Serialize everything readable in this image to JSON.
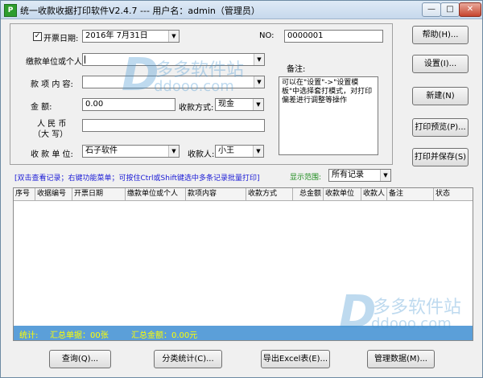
{
  "window": {
    "title": "统一收款收据打印软件V2.4.7 --- 用户名：admin（管理员）",
    "app_icon": "P",
    "controls": {
      "minimize": "—",
      "maximize": "□",
      "close": "✕"
    }
  },
  "form": {
    "date_checkbox_checked": true,
    "date_label": "开票日期:",
    "date_value": "2016年  7月31日",
    "no_label": "NO:",
    "no_value": "0000001",
    "payer_label": "缴款单位或个人:",
    "payer_value": "",
    "item_label": "款  项  内  容:",
    "item_value": "",
    "amount_label": "金        额:",
    "amount_value": "0.00",
    "method_label": "收款方式:",
    "method_value": "现金",
    "rmb_label_top": "人    民    币",
    "rmb_label_bottom": "（大    写）",
    "rmb_value": "",
    "unit_label": "收  款  单  位:",
    "unit_value": "石子软件",
    "receiver_label": "收款人:",
    "receiver_value": "小王",
    "remark_label": "备注:",
    "remark_text": "可以在\"设置\"->\"设置模板\"中选择套打模式，对打印偏差进行调整等操作"
  },
  "side_buttons": [
    "帮助(H)...",
    "设置(I)...",
    "新建(N)",
    "打印预览(P)...",
    "打印并保存(S)"
  ],
  "list_hint": "[双击查看记录；右键功能菜单；可按住Ctrl或Shift键选中多条记录批量打印]",
  "range_label": "显示范围:",
  "range_value": "所有记录",
  "table": {
    "columns": [
      "序号",
      "收据编号",
      "开票日期",
      "缴款单位或个人",
      "款项内容",
      "收款方式",
      "总金额",
      "收款单位",
      "收款人",
      "备注",
      "状态"
    ],
    "rows": []
  },
  "status": {
    "stats_label": "统计:",
    "total_count": "汇总单据：00张",
    "total_amount": "汇总金额：0.00元"
  },
  "bottom_buttons": [
    "查询(Q)...",
    "分类统计(C)...",
    "导出Excel表(E)...",
    "管理数据(M)..."
  ],
  "watermark": {
    "brand": "多多软件站",
    "domain": "ddooo.com",
    "logo_letter": "D"
  }
}
